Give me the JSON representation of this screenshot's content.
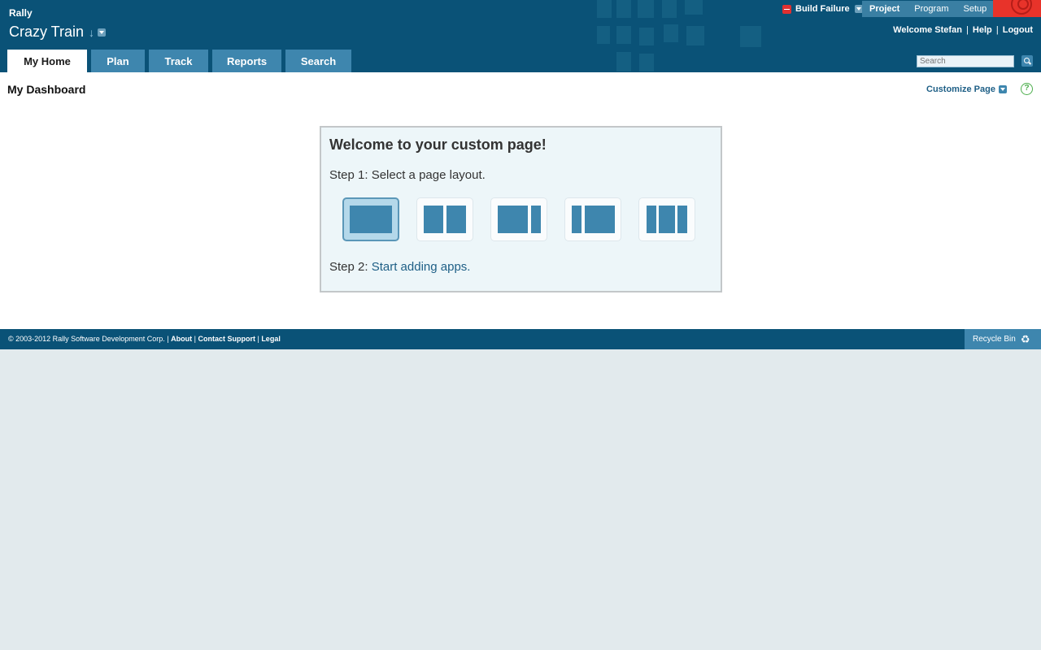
{
  "header": {
    "app_name": "Rally",
    "workspace": "Crazy Train",
    "build_status": "Build Failure",
    "top_nav": [
      "Project",
      "Program",
      "Setup"
    ],
    "welcome_user": "Welcome Stefan",
    "help": "Help",
    "logout": "Logout",
    "separator": "|",
    "search_placeholder": "Search"
  },
  "tabs": [
    "My Home",
    "Plan",
    "Track",
    "Reports",
    "Search"
  ],
  "content": {
    "page_title": "My Dashboard",
    "customize_label": "Customize Page",
    "help_icon": "?"
  },
  "welcome": {
    "title": "Welcome to your custom page!",
    "step1": "Step 1: Select a page layout.",
    "step2_prefix": "Step 2: ",
    "step2_link": "Start adding apps.",
    "selected_layout_index": 0
  },
  "footer": {
    "copyright": "© 2003-2012 Rally Software Development Corp.",
    "links": [
      "About",
      "Contact Support",
      "Legal"
    ],
    "recycle_bin": "Recycle Bin"
  },
  "colors": {
    "header_bg": "#0a5277",
    "tab_bg": "#3e86ae",
    "accent_red": "#e8332a",
    "panel_bg": "#edf6f9",
    "page_bg": "#e2eaed"
  }
}
